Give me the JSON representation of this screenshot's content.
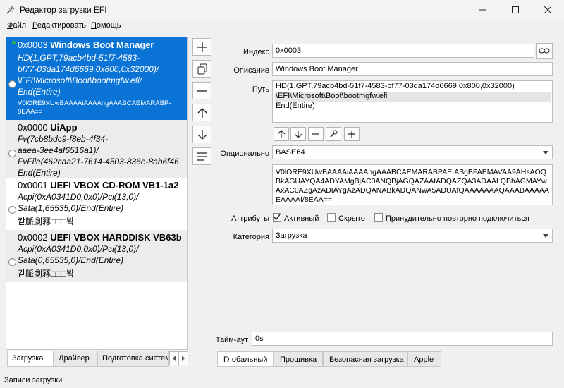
{
  "window": {
    "title": "Редактор загрузки EFI"
  },
  "menu": [
    {
      "label": "Файл",
      "underline": "Ф",
      "rest": "айл"
    },
    {
      "label": "Редактировать",
      "underline": "Р",
      "rest": "едактировать"
    },
    {
      "label": "Помощь",
      "underline": "П",
      "rest": "омощь"
    }
  ],
  "entries": [
    {
      "id": "0x0003",
      "name": "Windows Boot Manager",
      "lines": [
        "HD(1,GPT,79acb4bd-51f7-4583-",
        "bf77-03da174d6669,0x800,0x32000)/",
        "\\EFI\\Microsoft\\Boot\\bootmgfw.efi/",
        "End(Entire)"
      ],
      "extra": "V0lORE9XUwBAAAAiAAAAhgAAABCAEMARABP-",
      "extra2": "8EAA==",
      "selected": true,
      "default": true
    },
    {
      "id": "0x0000",
      "name": "UiApp",
      "lines": [
        "Fv(7cb8bdc9-f8eb-4f34-",
        "aaea-3ee4af6516a1)/",
        "FvFile(462caa21-7614-4503-836e-8ab6f46",
        "End(Entire)"
      ],
      "selected": false
    },
    {
      "id": "0x0001",
      "name": "UEFI VBOX CD-ROM VB1-1a2",
      "lines": [
        "Acpi(0xA0341D0,0x0)/Pci(13,0)/",
        "Sata(1,65535,0)/End(Entire)"
      ],
      "extra": "칻脈劇豩□□□뵉",
      "selected": false
    },
    {
      "id": "0x0002",
      "name": "UEFI VBOX HARDDISK VB63b",
      "lines": [
        "Acpi(0xA0341D0,0x0)/Pci(13,0)/",
        "Sata(0,65535,0)/End(Entire)"
      ],
      "extra": "칻脈劇豩□□□뵉",
      "selected": false
    }
  ],
  "left_tabs": [
    "Загрузка",
    "Драйвер",
    "Подготовка системе"
  ],
  "form": {
    "index_label": "Индекс",
    "index_value": "0x0003",
    "desc_label": "Описание",
    "desc_value": "Windows Boot Manager",
    "path_label": "Путь",
    "path_lines": [
      "HD(1,GPT,79acb4bd-51f7-4583-bf77-03da174d6669,0x800,0x32000)",
      "\\EFI\\Microsoft\\Boot\\bootmgfw.efi",
      "End(Entire)"
    ],
    "optional_label": "Опционально",
    "optional_format": "BASE64",
    "optional_data": "V0lORE9XUwBAAAAiAAAAhgAAABCAEMARABPAEIASgBFAEMAVAA9AHsAOQBkAGUAYQA4ADYAMgBjAC0ANQBjAGQAZAAtADQAZQA3ADAALQBhAGMAYwAxAC0AZgAzADIAYgAzADQANABkADQANwA5ADUAfQAAAAAAAQAAABAAAAAEAAAAf/8EAA==",
    "attributes_label": "Аттрибуты",
    "attr_active": "Активный",
    "attr_hidden": "Скрыто",
    "attr_reconnect": "Принудительно повторно подключиться",
    "category_label": "Категория",
    "category_value": "Загрузка",
    "timeout_label": "Тайм-аут",
    "timeout_value": "0s"
  },
  "bottom_tabs": [
    "Глобальный",
    "Прошивка",
    "Безопасная загрузка",
    "Apple"
  ],
  "status": "Записи загрузки",
  "colors": {
    "selection": "#0a74d6",
    "default_marker": "#2bbd3b"
  }
}
